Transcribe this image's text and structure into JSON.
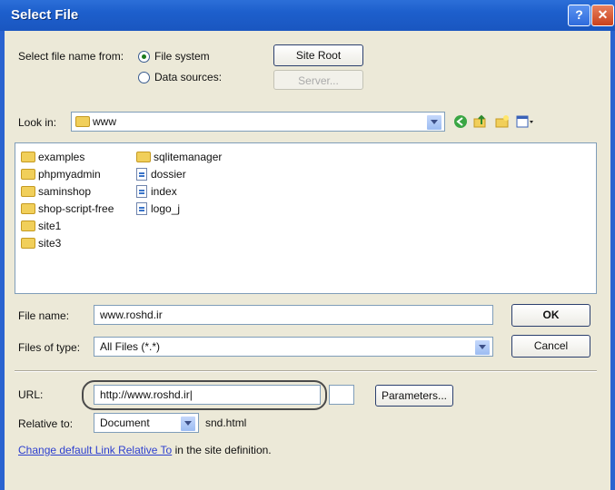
{
  "window": {
    "title": "Select File",
    "help_glyph": "?",
    "close_glyph": "✕"
  },
  "source": {
    "label": "Select file name from:",
    "options": [
      {
        "label": "File system",
        "selected": true
      },
      {
        "label": "Data sources:",
        "selected": false
      }
    ],
    "site_root_label": "Site Root",
    "server_label": "Server..."
  },
  "look_in": {
    "label": "Look in:",
    "value": "www"
  },
  "files": [
    {
      "name": "examples",
      "type": "folder"
    },
    {
      "name": "phpmyadmin",
      "type": "folder"
    },
    {
      "name": "saminshop",
      "type": "folder"
    },
    {
      "name": "shop-script-free",
      "type": "folder"
    },
    {
      "name": "site1",
      "type": "folder"
    },
    {
      "name": "site3",
      "type": "folder"
    },
    {
      "name": "sqlitemanager",
      "type": "folder"
    },
    {
      "name": "dossier",
      "type": "file"
    },
    {
      "name": "index",
      "type": "file"
    },
    {
      "name": "logo_j",
      "type": "file"
    }
  ],
  "file_name": {
    "label": "File name:",
    "value": "www.roshd.ir"
  },
  "files_of_type": {
    "label": "Files of type:",
    "value": "All Files (*.*)"
  },
  "ok_label": "OK",
  "cancel_label": "Cancel",
  "url": {
    "label": "URL:",
    "value": "http://www.roshd.ir|"
  },
  "parameters_label": "Parameters...",
  "relative_to": {
    "label": "Relative to:",
    "value": "Document",
    "suffix": "snd.html"
  },
  "footer": {
    "link_text": "Change default Link Relative To",
    "tail_text": " in the site definition."
  },
  "colors": {
    "title_bar": "#1d5fcc",
    "dialog_bg": "#ece9d8",
    "link": "#2d3fcf"
  }
}
